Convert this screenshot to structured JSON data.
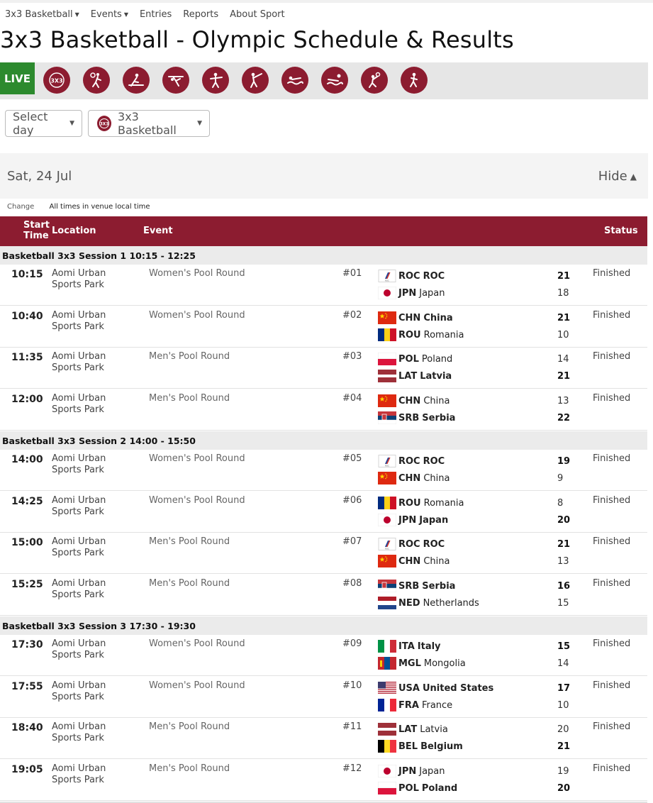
{
  "nav": {
    "items": [
      {
        "label": "3x3 Basketball",
        "has_caret": true
      },
      {
        "label": "Events",
        "has_caret": true
      },
      {
        "label": "Entries",
        "has_caret": false
      },
      {
        "label": "Reports",
        "has_caret": false
      },
      {
        "label": "About Sport",
        "has_caret": false
      }
    ]
  },
  "page_title": "3x3 Basketball - Olympic Schedule & Results",
  "live_bar": {
    "live_label": "LIVE",
    "sport_icons": [
      "basketball-3x3-icon",
      "basketball-icon",
      "rowing-icon",
      "gymnastics-icon",
      "shooting-icon",
      "fencing-icon",
      "swimming-icon",
      "water-polo-icon",
      "volleyball-icon",
      "athletics-icon"
    ]
  },
  "filters": {
    "day_label": "Select day",
    "sport_label": "3x3 Basketball"
  },
  "day": {
    "label": "Sat, 24 Jul",
    "toggle_label": "Hide"
  },
  "timezone": {
    "change_label": "Change",
    "note": "All times in venue local time"
  },
  "table": {
    "headers": {
      "start_time": "Start\nTime",
      "start_line1": "Start",
      "start_line2": "Time",
      "location": "Location",
      "event": "Event",
      "status": "Status"
    }
  },
  "colors": {
    "brand": "#8c1c30",
    "live": "#2c8a2e"
  },
  "sessions": [
    {
      "title": "Basketball 3x3 Session 1  10:15 - 12:25",
      "matches": [
        {
          "time": "10:15",
          "location": "Aomi Urban Sports Park",
          "event": "Women's Pool Round",
          "num": "#01",
          "t1": {
            "code": "ROC",
            "name": "ROC",
            "flag": "roc",
            "score": "21",
            "win": true
          },
          "t2": {
            "code": "JPN",
            "name": "Japan",
            "flag": "jpn",
            "score": "18",
            "win": false
          },
          "status": "Finished"
        },
        {
          "time": "10:40",
          "location": "Aomi Urban Sports Park",
          "event": "Women's Pool Round",
          "num": "#02",
          "t1": {
            "code": "CHN",
            "name": "China",
            "flag": "chn",
            "score": "21",
            "win": true
          },
          "t2": {
            "code": "ROU",
            "name": "Romania",
            "flag": "rou",
            "score": "10",
            "win": false
          },
          "status": "Finished"
        },
        {
          "time": "11:35",
          "location": "Aomi Urban Sports Park",
          "event": "Men's Pool Round",
          "num": "#03",
          "t1": {
            "code": "POL",
            "name": "Poland",
            "flag": "pol",
            "score": "14",
            "win": false
          },
          "t2": {
            "code": "LAT",
            "name": "Latvia",
            "flag": "lat",
            "score": "21",
            "win": true
          },
          "status": "Finished"
        },
        {
          "time": "12:00",
          "location": "Aomi Urban Sports Park",
          "event": "Men's Pool Round",
          "num": "#04",
          "t1": {
            "code": "CHN",
            "name": "China",
            "flag": "chn",
            "score": "13",
            "win": false
          },
          "t2": {
            "code": "SRB",
            "name": "Serbia",
            "flag": "srb",
            "score": "22",
            "win": true
          },
          "status": "Finished"
        }
      ]
    },
    {
      "title": "Basketball 3x3 Session 2  14:00 - 15:50",
      "matches": [
        {
          "time": "14:00",
          "location": "Aomi Urban Sports Park",
          "event": "Women's Pool Round",
          "num": "#05",
          "t1": {
            "code": "ROC",
            "name": "ROC",
            "flag": "roc",
            "score": "19",
            "win": true
          },
          "t2": {
            "code": "CHN",
            "name": "China",
            "flag": "chn",
            "score": "9",
            "win": false
          },
          "status": "Finished"
        },
        {
          "time": "14:25",
          "location": "Aomi Urban Sports Park",
          "event": "Women's Pool Round",
          "num": "#06",
          "t1": {
            "code": "ROU",
            "name": "Romania",
            "flag": "rou",
            "score": "8",
            "win": false
          },
          "t2": {
            "code": "JPN",
            "name": "Japan",
            "flag": "jpn",
            "score": "20",
            "win": true
          },
          "status": "Finished"
        },
        {
          "time": "15:00",
          "location": "Aomi Urban Sports Park",
          "event": "Men's Pool Round",
          "num": "#07",
          "t1": {
            "code": "ROC",
            "name": "ROC",
            "flag": "roc",
            "score": "21",
            "win": true
          },
          "t2": {
            "code": "CHN",
            "name": "China",
            "flag": "chn",
            "score": "13",
            "win": false
          },
          "status": "Finished"
        },
        {
          "time": "15:25",
          "location": "Aomi Urban Sports Park",
          "event": "Men's Pool Round",
          "num": "#08",
          "t1": {
            "code": "SRB",
            "name": "Serbia",
            "flag": "srb",
            "score": "16",
            "win": true
          },
          "t2": {
            "code": "NED",
            "name": "Netherlands",
            "flag": "ned",
            "score": "15",
            "win": false
          },
          "status": "Finished"
        }
      ]
    },
    {
      "title": "Basketball 3x3 Session 3  17:30 - 19:30",
      "matches": [
        {
          "time": "17:30",
          "location": "Aomi Urban Sports Park",
          "event": "Women's Pool Round",
          "num": "#09",
          "t1": {
            "code": "ITA",
            "name": "Italy",
            "flag": "ita",
            "score": "15",
            "win": true
          },
          "t2": {
            "code": "MGL",
            "name": "Mongolia",
            "flag": "mgl",
            "score": "14",
            "win": false
          },
          "status": "Finished"
        },
        {
          "time": "17:55",
          "location": "Aomi Urban Sports Park",
          "event": "Women's Pool Round",
          "num": "#10",
          "t1": {
            "code": "USA",
            "name": "United States",
            "flag": "usa",
            "score": "17",
            "win": true
          },
          "t2": {
            "code": "FRA",
            "name": "France",
            "flag": "fra",
            "score": "10",
            "win": false
          },
          "status": "Finished"
        },
        {
          "time": "18:40",
          "location": "Aomi Urban Sports Park",
          "event": "Men's Pool Round",
          "num": "#11",
          "t1": {
            "code": "LAT",
            "name": "Latvia",
            "flag": "lat",
            "score": "20",
            "win": false
          },
          "t2": {
            "code": "BEL",
            "name": "Belgium",
            "flag": "bel",
            "score": "21",
            "win": true
          },
          "status": "Finished"
        },
        {
          "time": "19:05",
          "location": "Aomi Urban Sports Park",
          "event": "Men's Pool Round",
          "num": "#12",
          "t1": {
            "code": "JPN",
            "name": "Japan",
            "flag": "jpn",
            "score": "19",
            "win": false
          },
          "t2": {
            "code": "POL",
            "name": "Poland",
            "flag": "pol",
            "score": "20",
            "win": true
          },
          "status": "Finished"
        }
      ]
    }
  ]
}
